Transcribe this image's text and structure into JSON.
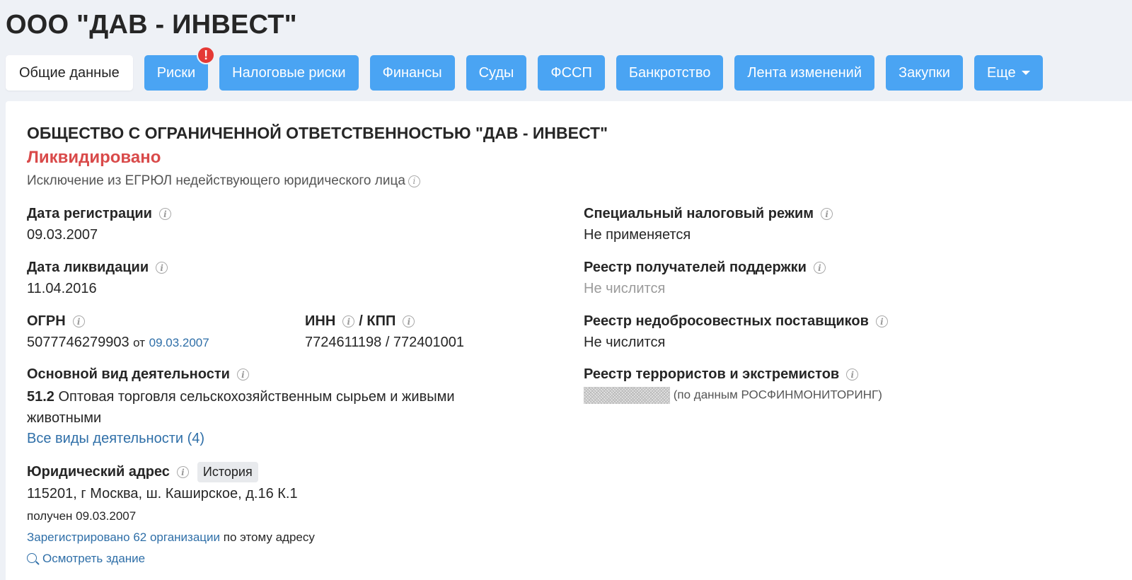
{
  "header": {
    "title": "ООО \"ДАВ - ИНВЕСТ\""
  },
  "tabs": [
    {
      "label": "Общие данные",
      "active": true
    },
    {
      "label": "Риски",
      "badge": "!"
    },
    {
      "label": "Налоговые риски"
    },
    {
      "label": "Финансы"
    },
    {
      "label": "Суды"
    },
    {
      "label": "ФССП"
    },
    {
      "label": "Банкротство"
    },
    {
      "label": "Лента изменений"
    },
    {
      "label": "Закупки"
    },
    {
      "label": "Еще"
    }
  ],
  "company": {
    "full_name": "ОБЩЕСТВО С ОГРАНИЧЕННОЙ ОТВЕТСТВЕННОСТЬЮ \"ДАВ - ИНВЕСТ\"",
    "status": "Ликвидировано",
    "status_reason": "Исключение из ЕГРЮЛ недействующего юридического лица"
  },
  "fields": {
    "reg_date_label": "Дата регистрации",
    "reg_date": "09.03.2007",
    "liq_date_label": "Дата ликвидации",
    "liq_date": "11.04.2016",
    "ogrn_label": "ОГРН",
    "ogrn": "5077746279903",
    "ogrn_from": "от",
    "ogrn_date": "09.03.2007",
    "inn_label": "ИНН",
    "kpp_label": "/ КПП",
    "inn_kpp": "7724611198 / 772401001",
    "activity_label": "Основной вид деятельности",
    "activity_code": "51.2",
    "activity_text": "Оптовая торговля сельскохозяйственным сырьем и живыми животными",
    "all_activities_link": "Все виды деятельности (4)",
    "address_label": "Юридический адрес",
    "history_button": "История",
    "address": "115201, г Москва, ш. Каширское, д.16 К.1",
    "address_received": "получен 09.03.2007",
    "registered_orgs_link": "Зарегистрировано 62 организации",
    "registered_orgs_suffix": "по этому адресу",
    "view_building_link": "Осмотреть здание"
  },
  "right": {
    "tax_regime_label": "Специальный налоговый режим",
    "tax_regime": "Не применяется",
    "support_registry_label": "Реестр получателей поддержки",
    "support_registry": "Не числится",
    "unfair_suppliers_label": "Реестр недобросовестных поставщиков",
    "unfair_suppliers": "Не числится",
    "terrorists_label": "Реестр террористов и экстремистов",
    "terrorists_source": "(по данным РОСФИНМОНИТОРИНГ)"
  },
  "colors": {
    "accent": "#4aa4f3",
    "liquidated": "#d94a4a",
    "link": "#2f6fa8",
    "badge": "#e53935"
  }
}
